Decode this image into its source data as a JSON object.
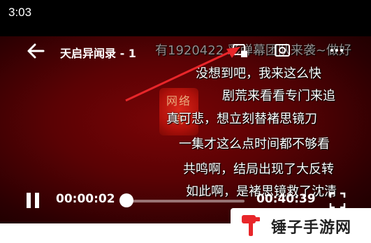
{
  "status": {
    "time": "3:03"
  },
  "player": {
    "title": "天启异闻录 - 1",
    "danmaku": [
      "有1920422 彩弹幕团队来袭~做好",
      "没想到吧，我来这么快",
      "剧荒来看看专门来追",
      "真可悲，想立刻替褚思镜刀",
      "一集才这么点时间都不够看",
      "共鸣啊，结局出现了大反转",
      "如此啊，是褚思镜救了沈清"
    ],
    "seal_text": "网络剧"
  },
  "controls": {
    "current_time": "00:00:02",
    "total_time": "00:40:39",
    "progress": 0.001
  },
  "watermark": {
    "text": "锤子手游网"
  },
  "colors": {
    "arrow": "#e8262a",
    "bg": "#5a0204"
  },
  "icons": [
    "back-arrow-icon",
    "danmaku-toggle-icon",
    "screenshot-icon",
    "more-icon",
    "pause-icon",
    "fullscreen-icon",
    "hammer-logo-icon"
  ]
}
